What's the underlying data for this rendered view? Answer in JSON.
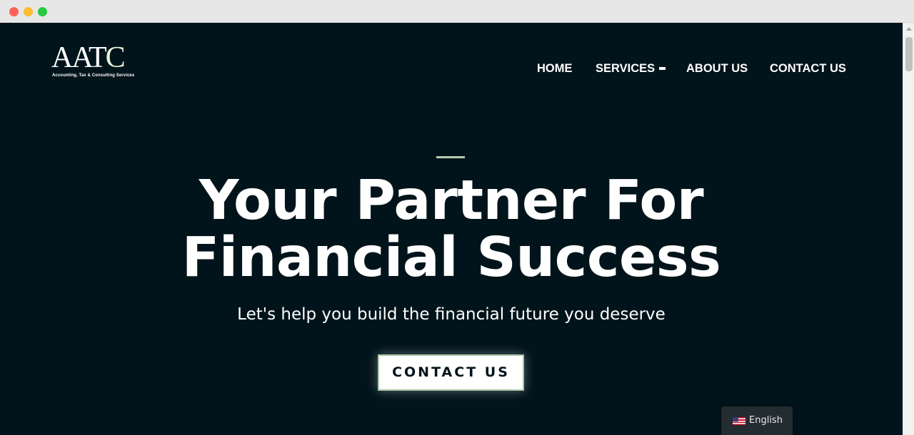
{
  "logo": {
    "letters_main": "AAT",
    "letters_accent": "C",
    "tagline": "Accounting, Tax & Consulting Services"
  },
  "nav": {
    "items": [
      {
        "label": "HOME"
      },
      {
        "label": "SERVICES"
      },
      {
        "label": "ABOUT US"
      },
      {
        "label": "CONTACT US"
      }
    ]
  },
  "hero": {
    "title_line1": "Your Partner For",
    "title_line2": "Financial Success",
    "subtitle": "Let's help you build the financial future you deserve",
    "cta_label": "CONTACT US"
  },
  "language_switcher": {
    "label": "English",
    "flag": "us-flag-icon"
  },
  "colors": {
    "background": "#02141b",
    "accent": "#a9c5a5",
    "text": "#ffffff"
  }
}
